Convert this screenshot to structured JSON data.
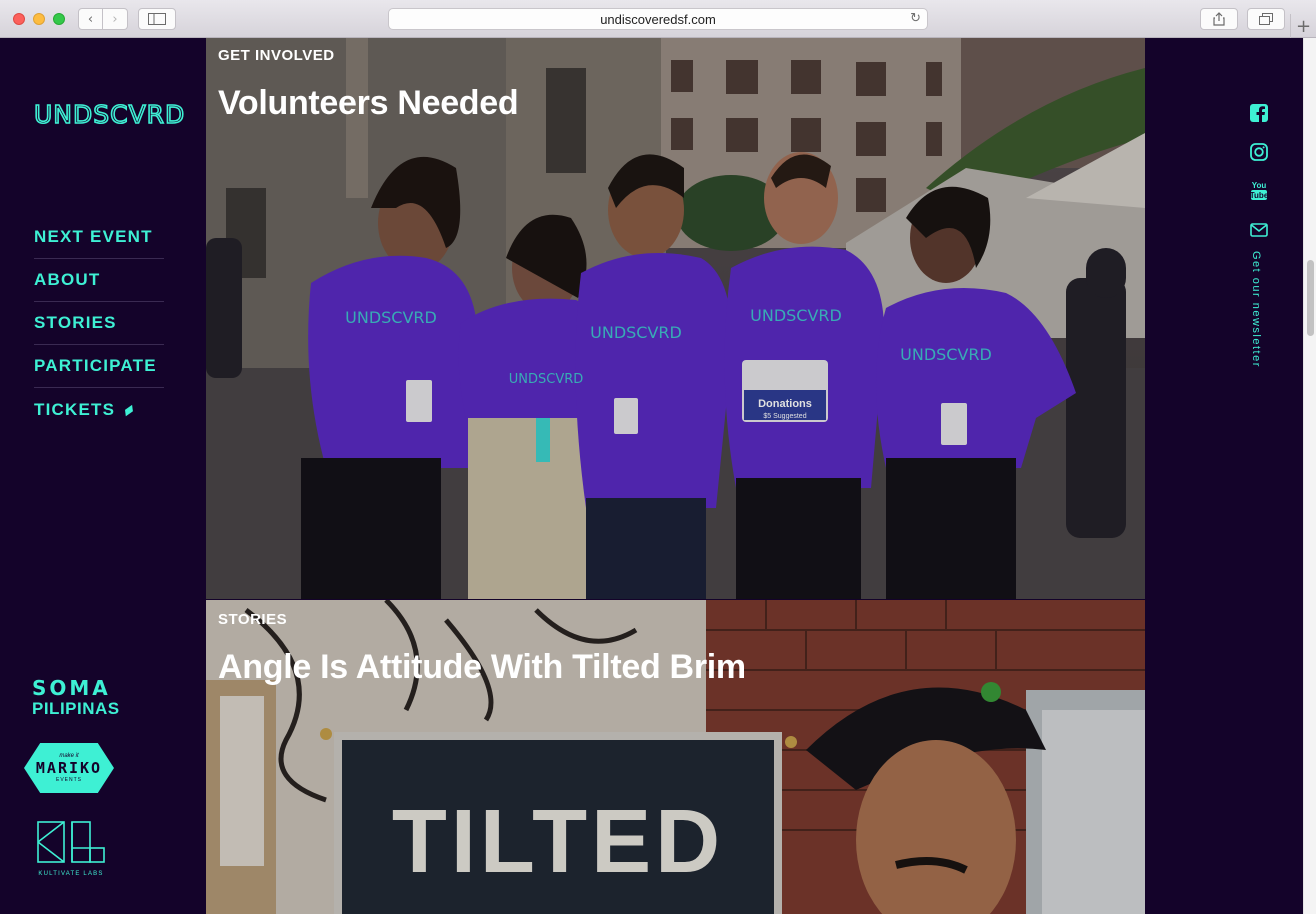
{
  "browser": {
    "url": "undiscoveredsf.com"
  },
  "sidebar": {
    "logo": "UNDSCVRD",
    "nav": [
      {
        "label": "NEXT EVENT"
      },
      {
        "label": "ABOUT"
      },
      {
        "label": "STORIES"
      },
      {
        "label": "PARTICIPATE"
      },
      {
        "label": "TICKETS"
      }
    ],
    "partners": {
      "soma_top": "SOMA",
      "soma_bottom": "PILIPINAS",
      "mariko_small": "make it",
      "mariko_big": "MARIKO",
      "mariko_events": "EVENTS",
      "kultivate": "KULTIVATE LABS"
    }
  },
  "cards": [
    {
      "kicker": "GET INVOLVED",
      "title": "Volunteers Needed",
      "sign_title": "Donations",
      "sign_sub": "$5 Suggested",
      "shirt_text": "UNDSCVRD"
    },
    {
      "kicker": "STORIES",
      "title": "Angle Is Attitude With Tilted Brim",
      "banner_text": "TILTED"
    }
  ],
  "right_rail": {
    "newsletter_label": "Get our newsletter",
    "icons": [
      "facebook-icon",
      "instagram-icon",
      "youtube-icon",
      "mail-icon"
    ],
    "youtube_text": "You Tube"
  },
  "colors": {
    "accent": "#3ef0d4",
    "background": "#14032a",
    "shirt": "#5b2bc4"
  }
}
